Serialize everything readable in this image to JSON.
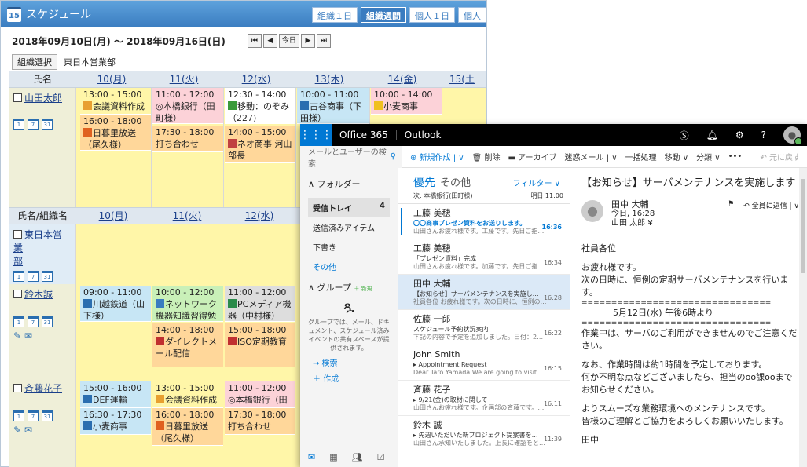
{
  "sched": {
    "title": "スケジュール",
    "cal_day": "15",
    "tabs": [
      "組織１日",
      "組織週間",
      "個人１日",
      "個人"
    ],
    "date_range": "2018年09月10日(月) ～ 2018年09月16日(日)",
    "nav": [
      "⏮",
      "◀",
      "今日",
      "▶",
      "⏭"
    ],
    "org_button": "組織選択",
    "org_name": "東日本営業部",
    "header1": {
      "name": "氏名",
      "days": [
        "10(月)",
        "11(火)",
        "12(水)",
        "13(木)",
        "14(金)",
        "15(土"
      ]
    },
    "header2": {
      "name": "氏名/組織名",
      "days": [
        "10(月)",
        "11(火)",
        "12(水)"
      ]
    },
    "users": {
      "u1": "山田太郎",
      "u2a": "東日本営業",
      "u2b": "部",
      "u3": "鈴木誠",
      "u4": "斉藤花子"
    },
    "cal_icons": [
      "1",
      "7",
      "31"
    ],
    "events": {
      "a1": "13:00 - 15:00",
      "a1t": "会議資料作成",
      "a2": "16:00 - 18:00",
      "a2t": "日暮里放送（尾久様）",
      "b1": "11:00 - 12:00",
      "b1t": "◎本橋銀行（田町様）",
      "b2": "17:30 - 18:00",
      "b2t": "打ち合わせ",
      "c1": "12:30 - 14:00",
      "c1t": "移動：のぞみ（227)",
      "c2": "14:00 - 15:00",
      "c2t": "ネオ商事 河山部長",
      "d1": "10:00 - 11:00",
      "d1t": "古谷商事（下田様）",
      "e1": "10:00 - 14:00",
      "e1t": "小麦商事",
      "f1": "09:00 - 11:00",
      "f1t": "川越鉄道（山下様）",
      "g1": "10:00 - 12:00",
      "g1t": "ネットワーク機器知識習得勉強会",
      "g2": "14:00 - 18:00",
      "g2t": "ダイレクトメール配信",
      "h1": "11:00 - 12:00",
      "h1t": "PCメディア機器（中村様）",
      "h2": "15:00 - 18:00",
      "h2t": "ISO定期教育",
      "i1": "15:00 - 16:00",
      "i1t": "DEF運輸",
      "i2": "16:30 - 17:30",
      "i2t": "小麦商事",
      "j1": "13:00 - 15:00",
      "j1t": "会議資料作成",
      "j2": "16:00 - 18:00",
      "j2t": "日暮里放送（尾久様）",
      "k1": "11:00 - 12:00",
      "k1t": "◎本橋銀行（田町",
      "k2": "17:30 - 18:00",
      "k2t": "打ち合わせ"
    }
  },
  "o365": {
    "brand": "Office 365",
    "app": "Outlook",
    "search": "メールとユーザーの検索",
    "toolbar": [
      "⊕ 新規作成 | ∨",
      "🗑 削除",
      "▬ アーカイブ",
      "迷惑メール | ∨",
      "一括処理",
      "移動 ∨",
      "分類 ∨",
      "•••"
    ],
    "undo": "↶ 元に戻す",
    "nav": {
      "folders": "∧ フォルダー",
      "inbox": "受信トレイ",
      "inbox_count": "4",
      "sent": "送信済みアイテム",
      "drafts": "下書き",
      "other": "その他",
      "groups": "∧ グループ",
      "new": "＋ 新規",
      "group_text": "グループでは、メール、ドキュメント、スケジュール済みイベントの共有スペースが提供されます。",
      "browse": "→ 検索",
      "create": "＋ 作成"
    },
    "tabs": {
      "focused": "優先",
      "other": "その他",
      "filter": "フィルター ∨"
    },
    "next": {
      "label": "次: 本橋銀行(田町様)",
      "time": "明日 11:00"
    },
    "messages": [
      {
        "from": "工藤 美穂",
        "subj": "〇〇商事プレゼン資料をお送りします。",
        "prev": "山田さんお疲れ様です。工藤です。先日ご指示いただきま…",
        "time": "16:36"
      },
      {
        "from": "工藤 美穂",
        "subj": "「プレゼン資料」完成",
        "prev": "山田さんお疲れ様です。加藤です。先日ご指示いただきま…",
        "time": "16:34"
      },
      {
        "from": "田中 大輔",
        "subj": "【お知らせ】サーバメンテナンスを実施します",
        "prev": "社員各位 お疲れ様です。次の日時に、恒例の定期サーバ…",
        "time": "16:28"
      },
      {
        "from": "佐藤 一郎",
        "subj": "スケジュール予約状況案内",
        "prev": "下記の内容で予定を追加しました。日付：2018/09/2…",
        "time": "16:22"
      },
      {
        "from": "John Smith",
        "subj": "▸ Appointment Request",
        "prev": "Dear Taro Yamada We are going to visit the T…",
        "time": "16:15"
      },
      {
        "from": "斉藤 花子",
        "subj": "▸ 9/21(金)の取材に関して",
        "prev": "山田さんお疲れ様です。企画部の斉藤です。9/21(金)…",
        "time": "16:11"
      },
      {
        "from": "鈴木 誠",
        "subj": "▸ 先週いただいた新プロジェクト提案書を確認しました",
        "prev": "山田さん承知いたしました。上長に確認をとり、進めさせて…",
        "time": "11:39"
      }
    ],
    "reading": {
      "subject": "【お知らせ】サーバメンテナンスを実施します",
      "sender": "田中 大輔",
      "date": "今日, 16:28",
      "to": "山田 太郎 ¥",
      "reply": "↶ 全員に返信 | ∨",
      "body": [
        "社員各位",
        "",
        "お疲れ様です。",
        "次の日時に、恒例の定期サーバメンテナンスを行います。",
        "================================",
        "5月12日(水) 午後6時より",
        "================================",
        "作業中は、サーバのご利用ができませんのでご注意ください。",
        "",
        "なお、作業時間は約1時間を予定しております。",
        "何か不明な点などございましたら、担当のoo課ooまで",
        "お知らせください。",
        "",
        "よりスムーズな業務環境へのメンテナンスです。",
        "皆様のご理解とご協力をよろしくお願いいたします。",
        "",
        "田中"
      ]
    }
  }
}
